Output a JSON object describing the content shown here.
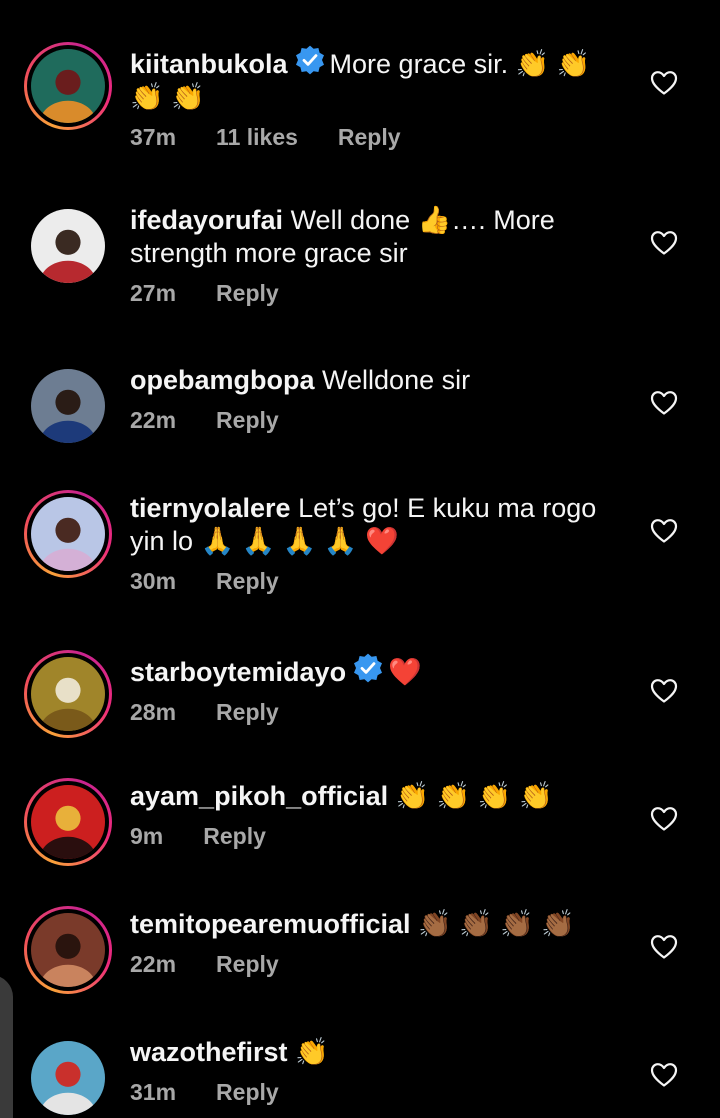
{
  "comments": [
    {
      "username": "kiitanbukola",
      "verified": true,
      "text": "More grace sir. 👏 👏 👏 👏",
      "time": "37m",
      "likes": "11 likes",
      "reply": "Reply",
      "story_ring": true,
      "avatar_colors": [
        "#1f6b5c",
        "#d98b2b",
        "#6a1d1d"
      ]
    },
    {
      "username": "ifedayorufai",
      "verified": false,
      "text": "Well done 👍…. More strength more grace sir",
      "time": "27m",
      "likes": "",
      "reply": "Reply",
      "story_ring": false,
      "avatar_colors": [
        "#ececec",
        "#b7292f",
        "#3a2a22"
      ]
    },
    {
      "username": "opebamgbopa",
      "verified": false,
      "text": "Welldone sir",
      "time": "22m",
      "likes": "",
      "reply": "Reply",
      "story_ring": false,
      "avatar_colors": [
        "#6d7d92",
        "#1d3a7a",
        "#2a1c16"
      ]
    },
    {
      "username": "tiernyolalere",
      "verified": false,
      "text": "Let’s go! E kuku ma rogo yin lo 🙏 🙏 🙏 🙏 ❤️",
      "time": "30m",
      "likes": "",
      "reply": "Reply",
      "story_ring": true,
      "avatar_colors": [
        "#b9c6e6",
        "#d4b0d6",
        "#4a2a22"
      ]
    },
    {
      "username": "starboytemidayo",
      "verified": true,
      "text": "❤️",
      "time": "28m",
      "likes": "",
      "reply": "Reply",
      "story_ring": true,
      "avatar_colors": [
        "#a0852a",
        "#7a5a1a",
        "#e8e0c8"
      ]
    },
    {
      "username": "ayam_pikoh_official",
      "verified": false,
      "text": "👏 👏 👏 👏",
      "time": "9m",
      "likes": "",
      "reply": "Reply",
      "story_ring": true,
      "avatar_colors": [
        "#cc1f1f",
        "#2a0e0e",
        "#e8b03a"
      ]
    },
    {
      "username": "temitopearemuofficial",
      "verified": false,
      "text": "👏🏾 👏🏾 👏🏾 👏🏾",
      "time": "22m",
      "likes": "",
      "reply": "Reply",
      "story_ring": true,
      "avatar_colors": [
        "#7a3a2a",
        "#c9835e",
        "#2a140e"
      ]
    },
    {
      "username": "wazothefirst",
      "verified": false,
      "text": "👏",
      "time": "31m",
      "likes": "",
      "reply": "Reply",
      "story_ring": false,
      "avatar_colors": [
        "#5aa6c8",
        "#e4e4e4",
        "#c9302c"
      ]
    }
  ],
  "colors": {
    "background": "#000000",
    "text": "#f5f5f5",
    "meta": "#a8a8a8",
    "verified": "#3897f0"
  },
  "icons": {
    "like": "heart-outline-icon",
    "verified": "verified-badge-icon"
  }
}
